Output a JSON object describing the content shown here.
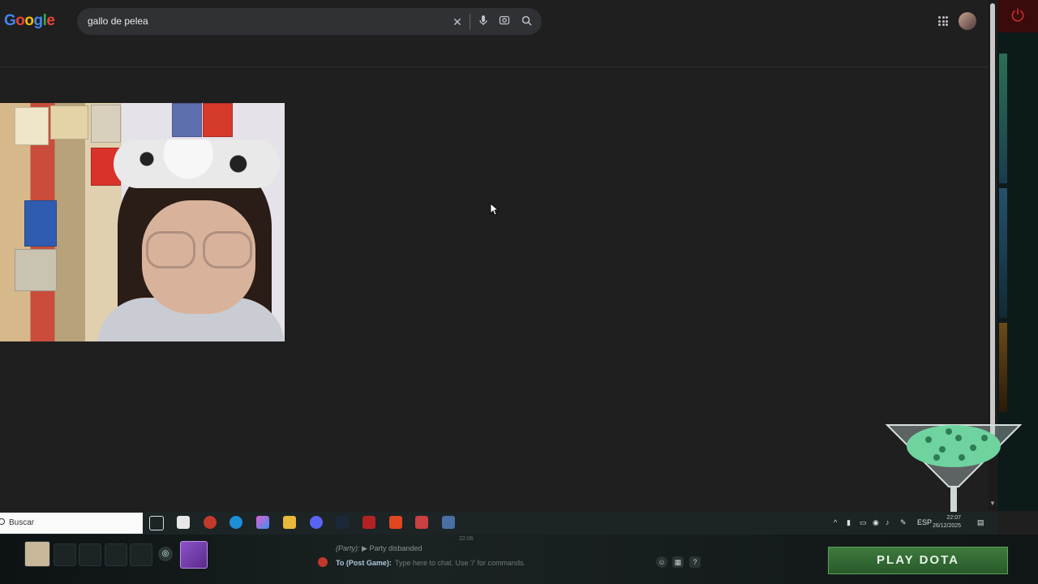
{
  "google": {
    "logo": "Google",
    "search_query": "gallo de pelea"
  },
  "taskbar": {
    "search_placeholder": "Buscar",
    "tray_language": "ESP",
    "clock_time": "22:07",
    "clock_date": "26/12/2025"
  },
  "dota": {
    "party_label": "(Party):",
    "party_message": "Party disbanded",
    "timestamp": "22:06",
    "chat_target": "To (Post Game):",
    "chat_placeholder": "Type here to chat. Use '/' for commands.",
    "help": "?",
    "play_button": "PLAY DOTA"
  },
  "colors": {
    "accent_play": "#3e7a3d",
    "power": "#d52e2e",
    "search_bg": "#303134"
  }
}
